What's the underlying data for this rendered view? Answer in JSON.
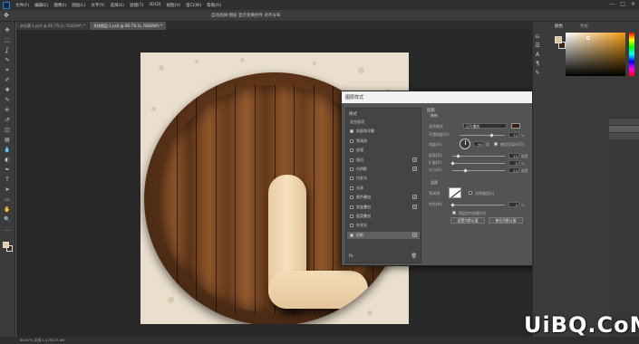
{
  "menubar": {
    "items": [
      "文件(F)",
      "编辑(E)",
      "图像(I)",
      "图层(L)",
      "文字(Y)",
      "选择(S)",
      "滤镜(T)",
      "3D(D)",
      "视图(V)",
      "窗口(W)",
      "帮助(H)"
    ],
    "window_controls": [
      "—",
      "□",
      "✕"
    ]
  },
  "optionsbar": {
    "label": "自动选择:图层 显示变换控件 对齐分布"
  },
  "tabs": [
    {
      "label": "未标题-1.psd @ 66.7% (L, RGB/8#) *",
      "active": false
    },
    {
      "label": "木纹图层-1.psd @ 66.7% (L, RGB/8#) *",
      "active": true
    }
  ],
  "toolbar": {
    "tools": [
      "move",
      "marquee",
      "lasso",
      "quick-select",
      "crop",
      "eyedropper",
      "healing",
      "brush",
      "stamp",
      "history-brush",
      "eraser",
      "gradient",
      "blur",
      "dodge",
      "pen",
      "type",
      "path-select",
      "shape",
      "hand",
      "zoom",
      "more"
    ],
    "glyphs": [
      "✥",
      "⬚",
      "ʆ",
      "✎",
      "⌗",
      "✐",
      "✚",
      "✎",
      "⎆",
      "↺",
      "◫",
      "▤",
      "💧",
      "◐",
      "✒",
      "T",
      "➤",
      "▭",
      "✋",
      "🔍",
      "…"
    ]
  },
  "colors": {
    "foreground": "#e6cf9e",
    "background": "#3e2412",
    "accent": "#f29a10"
  },
  "dialog": {
    "title": "图层样式",
    "close_icon": "close-icon",
    "styles_header": "样式",
    "styles": [
      {
        "label": "混合选项",
        "checked": null,
        "has_plus": false,
        "selected": false
      },
      {
        "label": "斜面和浮雕",
        "checked": true,
        "has_plus": false,
        "selected": false
      },
      {
        "label": "等高线",
        "checked": false,
        "has_plus": false,
        "selected": false
      },
      {
        "label": "纹理",
        "checked": false,
        "has_plus": false,
        "selected": false
      },
      {
        "label": "描边",
        "checked": false,
        "has_plus": true,
        "selected": false
      },
      {
        "label": "内阴影",
        "checked": false,
        "has_plus": true,
        "selected": false
      },
      {
        "label": "内发光",
        "checked": false,
        "has_plus": false,
        "selected": false
      },
      {
        "label": "光泽",
        "checked": false,
        "has_plus": false,
        "selected": false
      },
      {
        "label": "颜色叠加",
        "checked": false,
        "has_plus": true,
        "selected": false
      },
      {
        "label": "渐变叠加",
        "checked": false,
        "has_plus": true,
        "selected": false
      },
      {
        "label": "图案叠加",
        "checked": false,
        "has_plus": false,
        "selected": false
      },
      {
        "label": "外发光",
        "checked": false,
        "has_plus": false,
        "selected": false
      },
      {
        "label": "投影",
        "checked": true,
        "has_plus": true,
        "selected": true
      }
    ],
    "fx_label": "fx",
    "settings": {
      "section_title": "投影",
      "sub_title": "结构",
      "blend_mode_label": "混合模式",
      "blend_mode_value": "正片叠底",
      "shadow_color": "#3a1f10",
      "opacity_label": "不透明度(O):",
      "opacity_value": "70",
      "opacity_fraction": 0.7,
      "angle_label": "角度(A):",
      "angle_value": "90",
      "angle_unit": "度",
      "global_light_label": "使用全局光(G)",
      "global_light_checked": true,
      "distance_label": "距离(D):",
      "distance_value": "10",
      "distance_fraction": 0.1,
      "spread_label": "扩展(R):",
      "spread_value": "0",
      "spread_fraction": 0.0,
      "size_label": "大小(S):",
      "size_value": "24",
      "size_fraction": 0.24,
      "px_unit": "像素",
      "percent_unit": "%",
      "quality_title": "品质",
      "contour_label": "等高线:",
      "anti_alias_label": "消除锯齿(L)",
      "anti_alias_checked": false,
      "noise_label": "杂色(N):",
      "noise_value": "0",
      "noise_fraction": 0.0,
      "knockout_label": "图层挖空投影(U)",
      "knockout_checked": true,
      "set_default_button": "设置为默认值",
      "reset_default_button": "复位为默认值"
    },
    "buttons": {
      "ok": "确定",
      "cancel": "取消",
      "new_style": "新建样式(W)...",
      "preview_label": "预览(V)",
      "preview_checked": true
    }
  },
  "panels": {
    "color_tab": "颜色",
    "swatches_tab": "色板"
  },
  "statusbar": {
    "text": "66.67%   文档:1.47M/27.6M"
  },
  "watermark": {
    "text": "UiBQ.CoM"
  }
}
